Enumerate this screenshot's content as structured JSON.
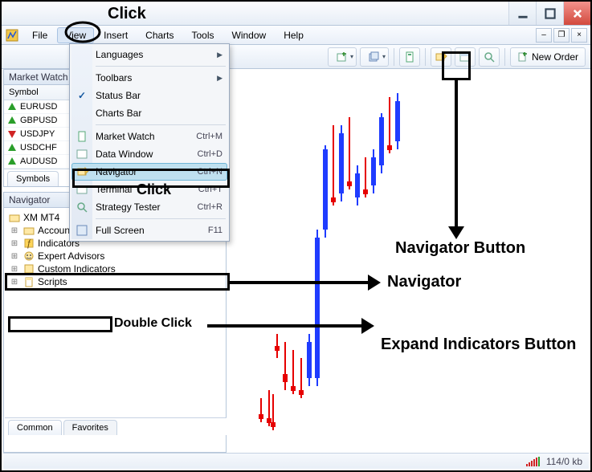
{
  "menubar": {
    "items": [
      "File",
      "View",
      "Insert",
      "Charts",
      "Tools",
      "Window",
      "Help"
    ]
  },
  "mdi": {
    "min": "–",
    "restore": "❐",
    "close": "×"
  },
  "toolbar": {
    "new_order_label": "New Order"
  },
  "dropdown": {
    "languages": "Languages",
    "toolbars": "Toolbars",
    "status_bar": "Status Bar",
    "charts_bar": "Charts Bar",
    "market_watch": {
      "label": "Market Watch",
      "shortcut": "Ctrl+M"
    },
    "data_window": {
      "label": "Data Window",
      "shortcut": "Ctrl+D"
    },
    "navigator": {
      "label": "Navigator",
      "shortcut": "Ctrl+N"
    },
    "terminal": {
      "label": "Terminal",
      "shortcut": "Ctrl+T"
    },
    "strategy": {
      "label": "Strategy Tester",
      "shortcut": "Ctrl+R"
    },
    "fullscreen": {
      "label": "Full Screen",
      "shortcut": "F11"
    }
  },
  "market_watch": {
    "title": "Market Watch",
    "col_symbol": "Symbol",
    "rows": [
      {
        "symbol": "EURUSD",
        "dir": "up"
      },
      {
        "symbol": "GBPUSD",
        "dir": "up"
      },
      {
        "symbol": "USDJPY",
        "dir": "down"
      },
      {
        "symbol": "USDCHF",
        "dir": "up"
      },
      {
        "symbol": "AUDUSD",
        "dir": "up"
      }
    ],
    "tab_symbols": "Symbols"
  },
  "navigator": {
    "title": "Navigator",
    "root": "XM MT4",
    "items": [
      "Accounts",
      "Indicators",
      "Expert Advisors",
      "Custom Indicators",
      "Scripts"
    ],
    "tab_common": "Common",
    "tab_favorites": "Favorites"
  },
  "status": {
    "conn": "114/0 kb"
  },
  "annotations": {
    "click1": "Click",
    "click2": "Click",
    "navigator_button": "Navigator Button",
    "navigator": "Navigator",
    "expand_indicators": "Expand Indicators Button",
    "double_click": "Double Click"
  }
}
